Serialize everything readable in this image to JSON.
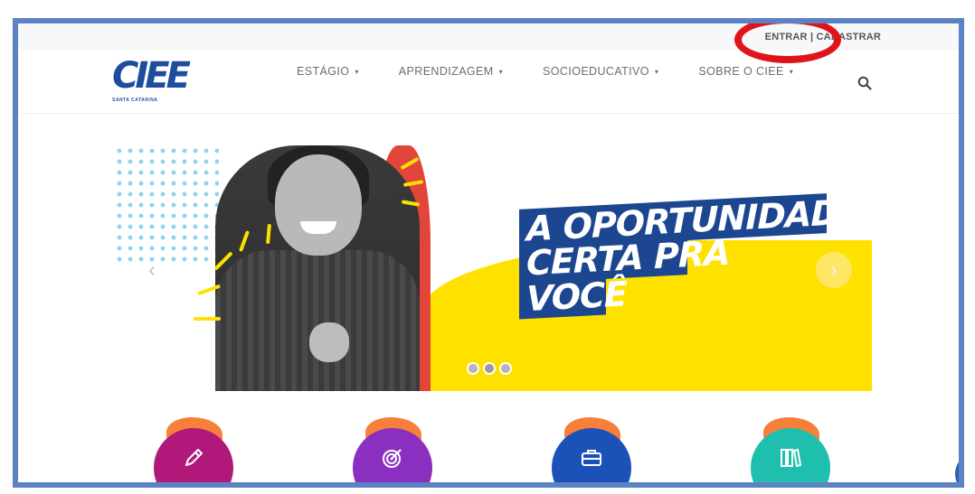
{
  "header": {
    "login_link": "ENTRAR",
    "separator": "|",
    "register_link": "CADASTRAR",
    "logo_text": "CIEE",
    "logo_subtitle": "SANTA CATARINA"
  },
  "nav": {
    "items": [
      {
        "label": "ESTÁGIO",
        "caret": "▾"
      },
      {
        "label": "APRENDIZAGEM",
        "caret": "▾"
      },
      {
        "label": "SOCIOEDUCATIVO",
        "caret": "▾"
      },
      {
        "label": "SOBRE O CIEE",
        "caret": "▾"
      }
    ],
    "search_icon": "search-icon"
  },
  "hero": {
    "headline_lines": [
      "A OPORTUNIDADE",
      "CERTA PRA",
      "VOCÊ"
    ],
    "prev_arrow": "‹",
    "next_arrow": "›",
    "slides": 3,
    "active_slide": 1
  },
  "categories": [
    {
      "icon": "pencil-icon",
      "color": "#b0197a"
    },
    {
      "icon": "target-icon",
      "color": "#8a2fc0"
    },
    {
      "icon": "briefcase-icon",
      "color": "#1c52b8"
    },
    {
      "icon": "books-icon",
      "color": "#1fbfae"
    }
  ],
  "annotation": {
    "color": "#e0121b"
  },
  "colors": {
    "brand_blue": "#1d4e9e",
    "yellow": "#ffe100",
    "frame": "#5b83c4"
  }
}
